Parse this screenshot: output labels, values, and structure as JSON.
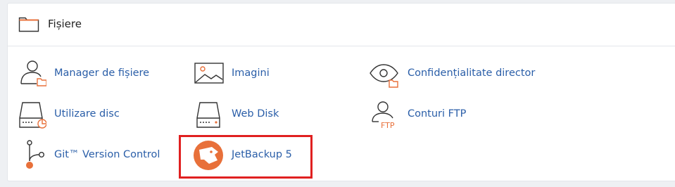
{
  "section": {
    "title": "Fișiere",
    "icon": "folder-icon"
  },
  "items": [
    {
      "label": "Manager de fișiere",
      "icon": "file-manager-icon"
    },
    {
      "label": "Imagini",
      "icon": "images-icon"
    },
    {
      "label": "Confidențialitate director",
      "icon": "directory-privacy-icon"
    },
    {
      "label": "Utilizare disc",
      "icon": "disk-usage-icon"
    },
    {
      "label": "Web Disk",
      "icon": "web-disk-icon"
    },
    {
      "label": "Conturi FTP",
      "icon": "ftp-accounts-icon"
    },
    {
      "label": "Git™ Version Control",
      "icon": "git-icon"
    },
    {
      "label": "JetBackup 5",
      "icon": "jetbackup-icon"
    }
  ],
  "colors": {
    "link": "#2a5ea8",
    "accent": "#e8703a",
    "highlight": "#e02020"
  },
  "ftp_icon_text": "FTP"
}
